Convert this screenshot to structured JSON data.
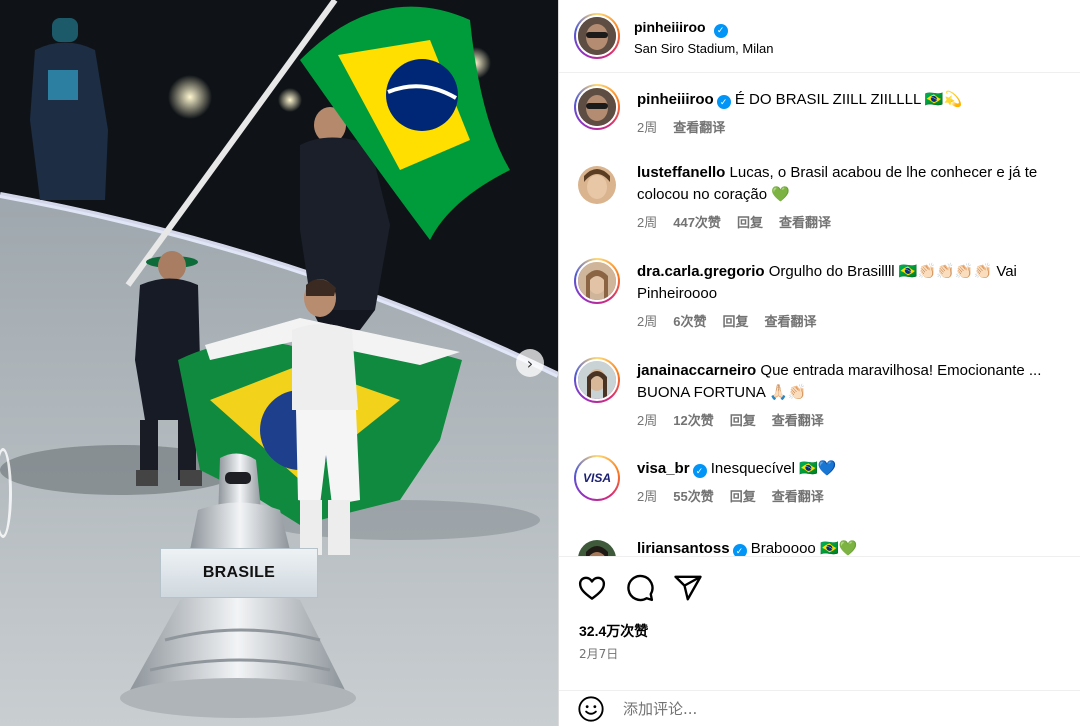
{
  "photo": {
    "sign_text": "BRASILE"
  },
  "header": {
    "username": "pinheiiiroo",
    "location": "San Siro Stadium, Milan"
  },
  "comments": [
    {
      "username": "pinheiiiroo",
      "verified": true,
      "text": "É DO BRASIL ZIILL ZIILLLL 🇧🇷💫",
      "time": "2周",
      "likes": "",
      "reply": "",
      "translate": "查看翻译"
    },
    {
      "username": "lusteffanello",
      "verified": false,
      "text": "Lucas, o Brasil acabou de lhe conhecer e já te colocou no coração 💚",
      "time": "2周",
      "likes": "447次赞",
      "reply": "回复",
      "translate": "查看翻译"
    },
    {
      "username": "dra.carla.gregorio",
      "verified": false,
      "text": "Orgulho do Brasillll 🇧🇷👏🏻👏🏻👏🏻👏🏻 Vai Pinheiroooo",
      "time": "2周",
      "likes": "6次赞",
      "reply": "回复",
      "translate": "查看翻译"
    },
    {
      "username": "janainaccarneiro",
      "verified": false,
      "text": "Que entrada maravilhosa! Emocionante ... BUONA FORTUNA 🙏🏻👏🏻",
      "time": "2周",
      "likes": "12次赞",
      "reply": "回复",
      "translate": "查看翻译"
    },
    {
      "username": "visa_br",
      "verified": true,
      "text": "Inesquecível 🇧🇷💙",
      "time": "2周",
      "likes": "55次赞",
      "reply": "回复",
      "translate": "查看翻译",
      "avatar_text": "VISA"
    },
    {
      "username": "liriansantoss",
      "verified": true,
      "text": "Braboooo 🇧🇷💚"
    }
  ],
  "actions": {
    "likes": "32.4万次赞",
    "date": "2月7日"
  },
  "add_comment": {
    "placeholder": "添加评论..."
  },
  "colors": {
    "verified": "#0095f6",
    "muted": "#737373",
    "flag_green": "#009c3b",
    "flag_yellow": "#ffdf00",
    "flag_blue": "#002776"
  }
}
